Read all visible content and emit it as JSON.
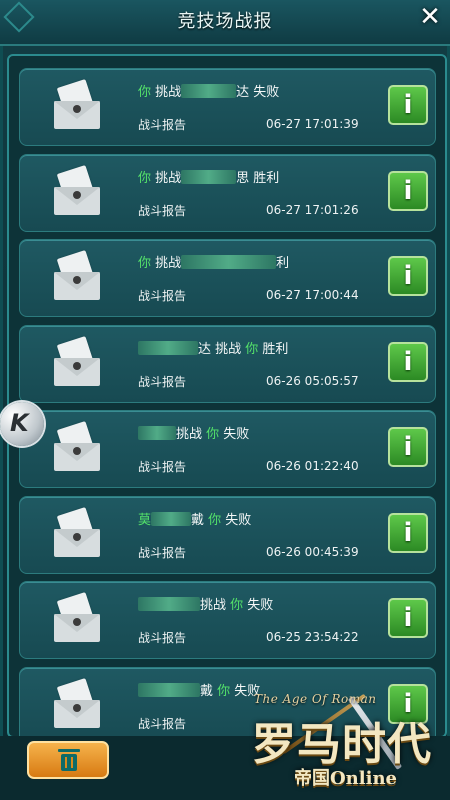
{
  "header": {
    "title": "竞技场战报",
    "close_label": "✕"
  },
  "report_list": [
    {
      "prefix": "你",
      "verb": " 挑战",
      "blurred": true,
      "suffix": "达 失败",
      "kind": "you-first",
      "subtitle": "战斗报告",
      "time": "06-27 17:01:39"
    },
    {
      "prefix": "你",
      "verb": " 挑战",
      "blurred": true,
      "suffix": "思 胜利",
      "kind": "you-first",
      "subtitle": "战斗报告",
      "time": "06-27 17:01:26"
    },
    {
      "prefix": "你",
      "verb": " 挑战",
      "blurred": true,
      "suffix": "利",
      "kind": "you-first",
      "subtitle": "战斗报告",
      "time": "06-27 17:00:44"
    },
    {
      "prefix": "",
      "verb": "",
      "blurred": true,
      "suffix": "达 挑战 ",
      "you": "你",
      "end": " 胜利",
      "kind": "you-second",
      "subtitle": "战斗报告",
      "time": "06-26 05:05:57"
    },
    {
      "prefix": "",
      "verb": "",
      "blurred": true,
      "suffix": "挑战 ",
      "you": "你",
      "end": " 失败",
      "kind": "you-second",
      "subtitle": "战斗报告",
      "time": "06-26 01:22:40"
    },
    {
      "prefix": "莫",
      "verb": "",
      "blurred": true,
      "suffix": "戴 ",
      "you": "你",
      "end": " 失败",
      "kind": "you-second",
      "subtitle": "战斗报告",
      "time": "06-26 00:45:39"
    },
    {
      "prefix": "",
      "verb": "",
      "blurred": true,
      "suffix": "挑战 ",
      "you": "你",
      "end": " 失败",
      "kind": "you-second",
      "subtitle": "战斗报告",
      "time": "06-25 23:54:22"
    },
    {
      "prefix": "",
      "verb": "",
      "blurred": true,
      "suffix": "戴 ",
      "you": "你",
      "end": " 失败",
      "kind": "you-second",
      "subtitle": "战斗报告",
      "time": ""
    }
  ],
  "info_button_label": "i",
  "delete_button": {
    "icon": "trash-icon"
  },
  "overlay_icon_label": "K",
  "branding": {
    "subtitle": "The Age Of Roman",
    "main": "罗马时代",
    "small": "帝国Online"
  },
  "colors": {
    "you": "#54e26a",
    "accent": "#2b8b8e",
    "info": "#3ca631",
    "delete": "#e79a2a"
  }
}
